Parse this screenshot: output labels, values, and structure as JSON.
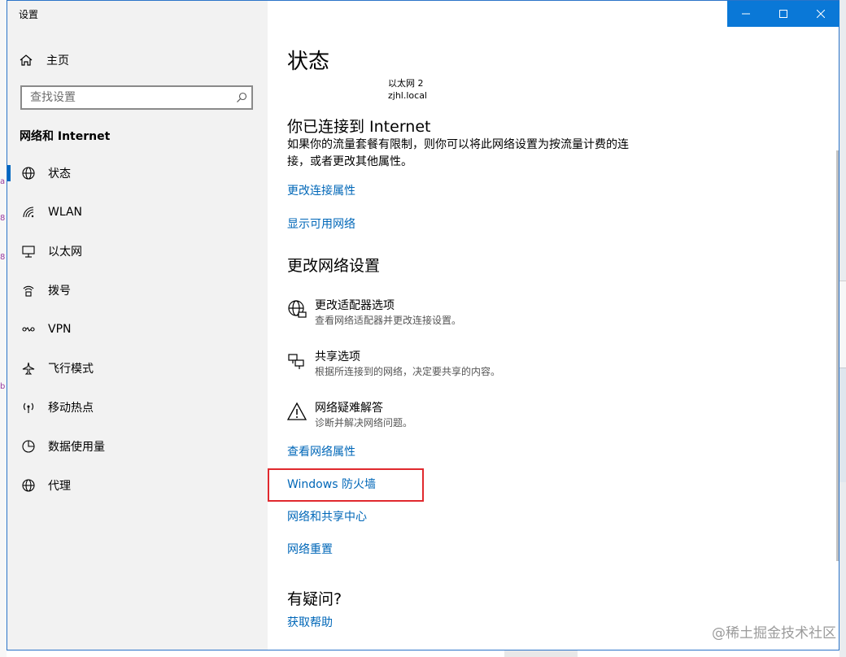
{
  "app": {
    "title": "设置"
  },
  "sidebar": {
    "home_label": "主页",
    "search_placeholder": "查找设置",
    "section": "网络和 Internet",
    "items": [
      {
        "label": "状态",
        "icon": "globe-icon",
        "active": true
      },
      {
        "label": "WLAN",
        "icon": "wifi-icon"
      },
      {
        "label": "以太网",
        "icon": "ethernet-icon"
      },
      {
        "label": "拨号",
        "icon": "dialup-icon"
      },
      {
        "label": "VPN",
        "icon": "vpn-icon"
      },
      {
        "label": "飞行模式",
        "icon": "airplane-icon"
      },
      {
        "label": "移动热点",
        "icon": "hotspot-icon"
      },
      {
        "label": "数据使用量",
        "icon": "data-usage-icon"
      },
      {
        "label": "代理",
        "icon": "globe-icon"
      }
    ]
  },
  "main": {
    "title": "状态",
    "network": {
      "name": "以太网 2",
      "domain": "zjhl.local"
    },
    "connected_heading": "你已连接到 Internet",
    "connected_desc": "如果你的流量套餐有限制，则你可以将此网络设置为按流量计费的连接，或者更改其他属性。",
    "link_change_props": "更改连接属性",
    "link_show_networks": "显示可用网络",
    "change_heading": "更改网络设置",
    "options": [
      {
        "title": "更改适配器选项",
        "sub": "查看网络适配器并更改连接设置。",
        "icon": "adapter-globe-icon"
      },
      {
        "title": "共享选项",
        "sub": "根据所连接到的网络，决定要共享的内容。",
        "icon": "sharing-icon"
      },
      {
        "title": "网络疑难解答",
        "sub": "诊断并解决网络问题。",
        "icon": "warning-icon"
      }
    ],
    "link_view_props": "查看网络属性",
    "link_firewall": "Windows 防火墙",
    "link_sharing_center": "网络和共享中心",
    "link_reset": "网络重置",
    "question_heading": "有疑问?",
    "link_help": "获取帮助"
  },
  "watermark": "@稀土掘金技术社区",
  "colors": {
    "accent": "#0067b8",
    "titlebar": "#0a78d7",
    "highlight": "#e0292e"
  }
}
